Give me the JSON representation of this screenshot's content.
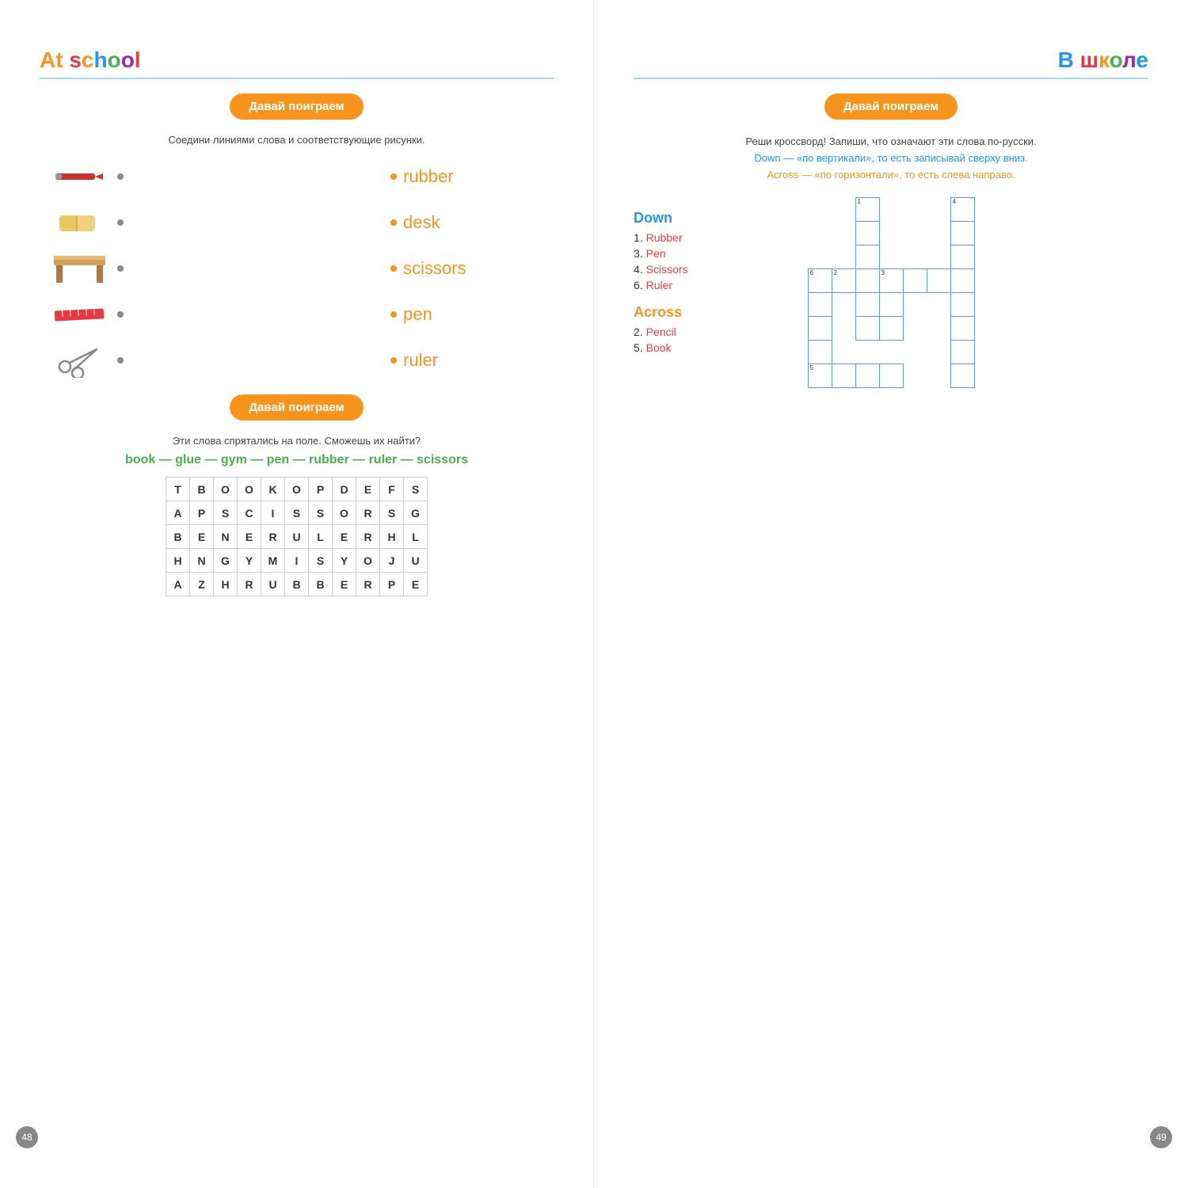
{
  "left_page": {
    "title": "At school",
    "title_colored": [
      {
        "char": "A",
        "color": "#f7941d"
      },
      {
        "char": "t",
        "color": "#f7941d"
      },
      {
        "char": " ",
        "color": "#333"
      },
      {
        "char": "s",
        "color": "#e63946"
      },
      {
        "char": "c",
        "color": "#f7941d"
      },
      {
        "char": "h",
        "color": "#2196f3"
      },
      {
        "char": "o",
        "color": "#4caf50"
      },
      {
        "char": "o",
        "color": "#9c27b0"
      },
      {
        "char": "l",
        "color": "#e63946"
      }
    ],
    "play_button_1": "Давай поиграем",
    "matching_instruction": "Соедини линиями слова и соответствующие рисунки.",
    "match_words": [
      "rubber",
      "desk",
      "scissors",
      "pen",
      "ruler"
    ],
    "play_button_2": "Давай поиграем",
    "wordsearch_instruction": "Эти слова спрятались на поле. Сможешь их найти?",
    "word_list": "book — glue — gym — pen — rubber — ruler — scissors",
    "grid": [
      [
        "T",
        "B",
        "O",
        "O",
        "K",
        "O",
        "P",
        "D",
        "E",
        "F",
        "S"
      ],
      [
        "A",
        "P",
        "S",
        "C",
        "I",
        "S",
        "S",
        "O",
        "R",
        "S",
        "G"
      ],
      [
        "B",
        "E",
        "N",
        "E",
        "R",
        "U",
        "L",
        "E",
        "R",
        "H",
        "L"
      ],
      [
        "H",
        "N",
        "G",
        "Y",
        "M",
        "I",
        "S",
        "Y",
        "O",
        "J",
        "U"
      ],
      [
        "A",
        "Z",
        "H",
        "R",
        "U",
        "B",
        "B",
        "E",
        "R",
        "P",
        "E"
      ]
    ],
    "page_number": "48"
  },
  "right_page": {
    "title": "В школе",
    "play_button": "Давай поиграем",
    "instruction_line1": "Реши кроссворд! Запиши, что означают эти слова по-русски.",
    "instruction_line2": "Down — «по вертикали», то есть записывай сверху вниз.",
    "instruction_line3": "Across — «по горизонтали», то есть слева направо.",
    "down_heading": "Down",
    "down_clues": [
      {
        "num": "1.",
        "word": "Rubber"
      },
      {
        "num": "3.",
        "word": "Pen"
      },
      {
        "num": "4.",
        "word": "Scissors"
      },
      {
        "num": "6.",
        "word": "Ruler"
      }
    ],
    "across_heading": "Across",
    "across_clues": [
      {
        "num": "2.",
        "word": "Pencil"
      },
      {
        "num": "5.",
        "word": "Book"
      }
    ],
    "page_number": "49"
  }
}
